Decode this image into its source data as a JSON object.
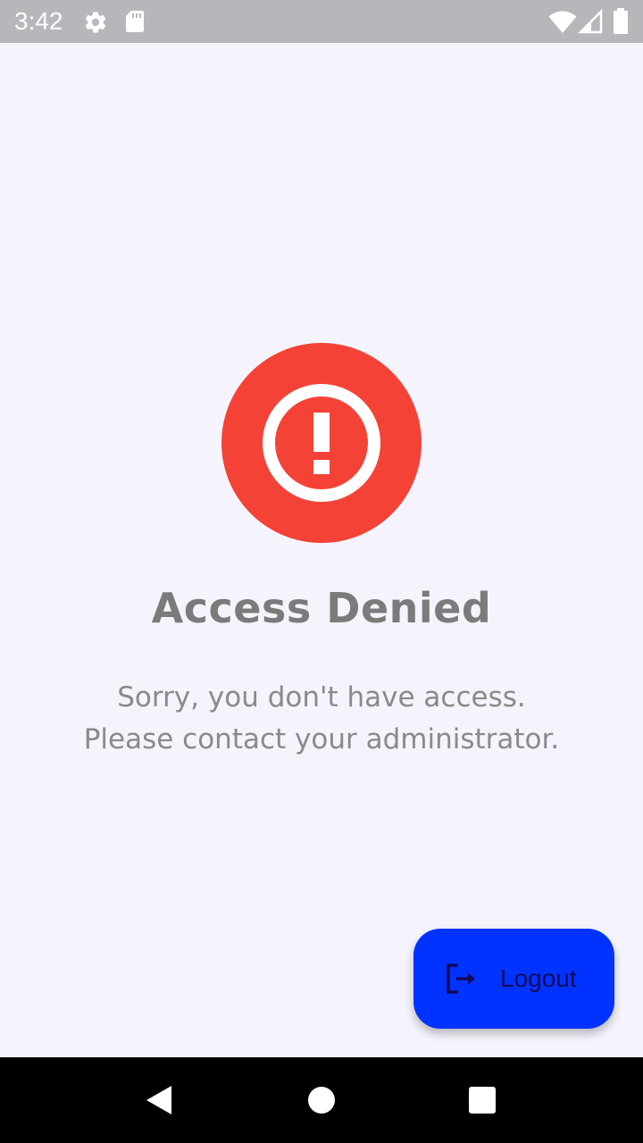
{
  "status_bar": {
    "time": "3:42",
    "icons": [
      "settings-gear-icon",
      "sd-card-icon",
      "wifi-icon",
      "cell-signal-icon",
      "battery-icon"
    ]
  },
  "main": {
    "alert_icon": "error-exclamation-icon",
    "title": "Access Denied",
    "message_line1": "Sorry, you don't have access.",
    "message_line2": "Please contact your administrator."
  },
  "fab": {
    "icon": "logout-icon",
    "label": "Logout"
  },
  "nav_bar": {
    "buttons": [
      "back-icon",
      "home-icon",
      "recents-icon"
    ]
  },
  "colors": {
    "background": "#f5f4fc",
    "status_bar": "#b7b6bb",
    "alert_red": "#f44336",
    "fab_blue": "#0033ff",
    "fab_text": "#120a5a",
    "title_gray": "#7b7b7b",
    "message_gray": "#8a8a8a"
  }
}
